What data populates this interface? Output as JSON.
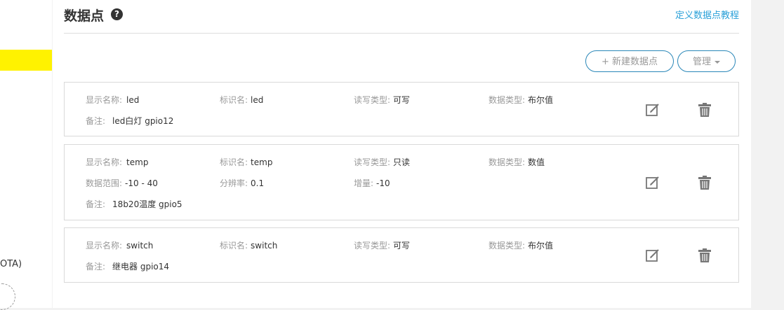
{
  "sidebar": {
    "ota_label": "OTA)"
  },
  "header": {
    "title": "数据点",
    "help_icon": "question-circle-icon",
    "tutorial_link": "定义数据点教程"
  },
  "toolbar": {
    "new_label": "+ 新建数据点",
    "manage_label": "管理"
  },
  "colors": {
    "accent_yellow": "#fff200",
    "link_blue": "#2aa0d8",
    "button_border": "#2a87b8"
  },
  "datapoints": [
    {
      "display_name_label": "显示名称:",
      "display_name": "led",
      "identifier_label": "标识名:",
      "identifier": "led",
      "rw_label": "读写类型:",
      "rw": "可写",
      "dtype_label": "数据类型:",
      "dtype": "布尔值",
      "note_label": "备注:",
      "note": "led白灯 gpio12"
    },
    {
      "display_name_label": "显示名称:",
      "display_name": "temp",
      "identifier_label": "标识名:",
      "identifier": "temp",
      "rw_label": "读写类型:",
      "rw": "只读",
      "dtype_label": "数据类型:",
      "dtype": "数值",
      "range_label": "数据范围:",
      "range": "-10 - 40",
      "resolution_label": "分辨率:",
      "resolution": "0.1",
      "increment_label": "增量:",
      "increment": "-10",
      "note_label": "备注:",
      "note": "18b20温度 gpio5"
    },
    {
      "display_name_label": "显示名称:",
      "display_name": "switch",
      "identifier_label": "标识名:",
      "identifier": "switch",
      "rw_label": "读写类型:",
      "rw": "可写",
      "dtype_label": "数据类型:",
      "dtype": "布尔值",
      "note_label": "备注:",
      "note": "继电器 gpio14"
    }
  ],
  "icons": {
    "edit": "edit-icon",
    "delete": "trash-icon"
  }
}
